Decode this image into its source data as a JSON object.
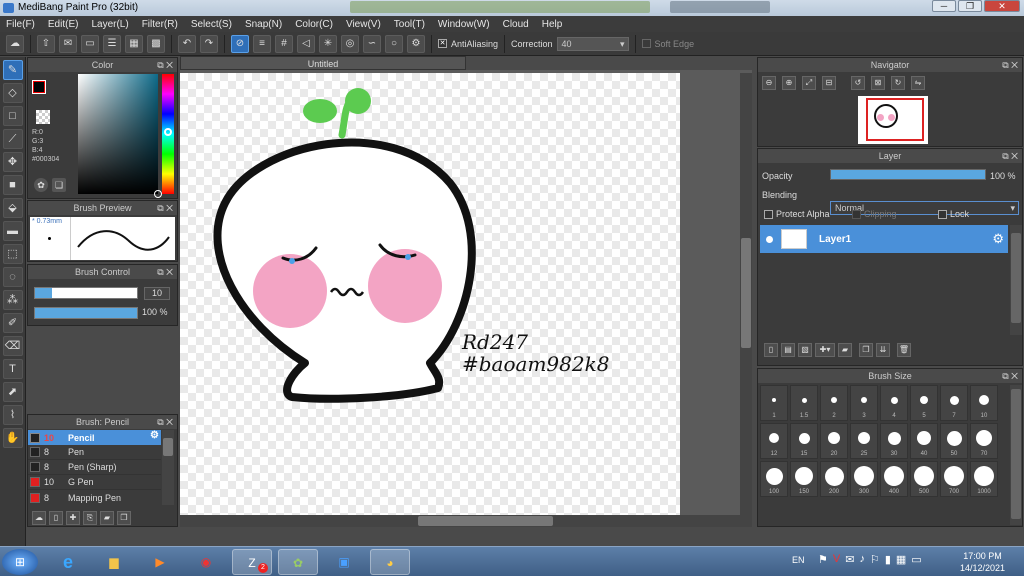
{
  "window": {
    "title": "MediBang Paint Pro (32bit)"
  },
  "menu": [
    "File(F)",
    "Edit(E)",
    "Layer(L)",
    "Filter(R)",
    "Select(S)",
    "Snap(N)",
    "Color(C)",
    "View(V)",
    "Tool(T)",
    "Window(W)",
    "Cloud",
    "Help"
  ],
  "toolbar": {
    "antialias_label": "AntiAliasing",
    "correction_label": "Correction",
    "correction_value": "40",
    "soft_edge_label": "Soft Edge"
  },
  "color_panel": {
    "title": "Color",
    "r": "R:0",
    "g": "G:3",
    "b": "B:4",
    "hex": "#000304",
    "fg_color": "#000304"
  },
  "brush_preview": {
    "title": "Brush Preview",
    "size": "* 0.73mm"
  },
  "brush_control": {
    "title": "Brush Control",
    "size_value": "10",
    "opacity_value": "100 %",
    "size_fraction": 0.85,
    "opacity_fraction": 1.0
  },
  "brush_list": {
    "title": "Brush: Pencil",
    "items": [
      {
        "size": "10",
        "name": "Pencil",
        "color": "#222222"
      },
      {
        "size": "8",
        "name": "Pen",
        "color": "#222222"
      },
      {
        "size": "8",
        "name": "Pen (Sharp)",
        "color": "#222222"
      },
      {
        "size": "10",
        "name": "G Pen",
        "color": "#e02020"
      },
      {
        "size": "8",
        "name": "Mapping Pen",
        "color": "#e02020"
      }
    ]
  },
  "document": {
    "tab_title": "Untitled",
    "text_line1": "Rd247",
    "text_line2": "#baoam982k8"
  },
  "navigator": {
    "title": "Navigator"
  },
  "layer_panel": {
    "title": "Layer",
    "opacity_label": "Opacity",
    "opacity_value": "100 %",
    "opacity_fraction": 1.0,
    "blending_label": "Blending",
    "blending_value": "Normal",
    "protect_alpha": "Protect Alpha",
    "clipping": "Clipping",
    "lock": "Lock",
    "layers": [
      {
        "name": "Layer1"
      }
    ]
  },
  "brush_size": {
    "title": "Brush Size",
    "sizes": [
      "1",
      "1.5",
      "2",
      "3",
      "4",
      "5",
      "7",
      "10",
      "12",
      "15",
      "20",
      "25",
      "30",
      "40",
      "50",
      "70",
      "100",
      "150",
      "200",
      "300",
      "400",
      "500",
      "700",
      "1000"
    ]
  },
  "taskbar": {
    "lang": "EN",
    "time": "17:00 PM",
    "date": "14/12/2021",
    "zalo_badge": "2"
  }
}
